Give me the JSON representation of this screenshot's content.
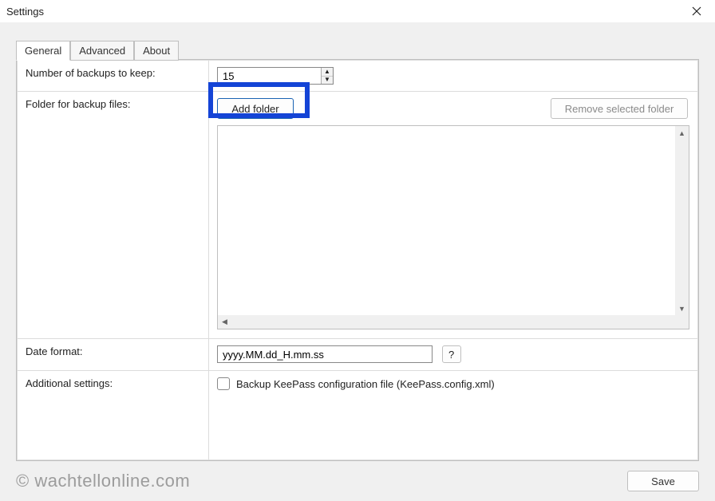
{
  "window": {
    "title": "Settings"
  },
  "tabs": {
    "general": "General",
    "advanced": "Advanced",
    "about": "About"
  },
  "rows": {
    "backups_label": "Number of backups to keep:",
    "backups_value": "15",
    "folder_label": "Folder for backup files:",
    "add_folder_btn": "Add folder",
    "remove_folder_btn": "Remove selected folder",
    "date_label": "Date format:",
    "date_value": "yyyy.MM.dd_H.mm.ss",
    "help_btn": "?",
    "additional_label": "Additional settings:",
    "backup_config_label": "Backup KeePass configuration file (KeePass.config.xml)"
  },
  "footer": {
    "watermark": "© wachtellonline.com",
    "save": "Save"
  }
}
